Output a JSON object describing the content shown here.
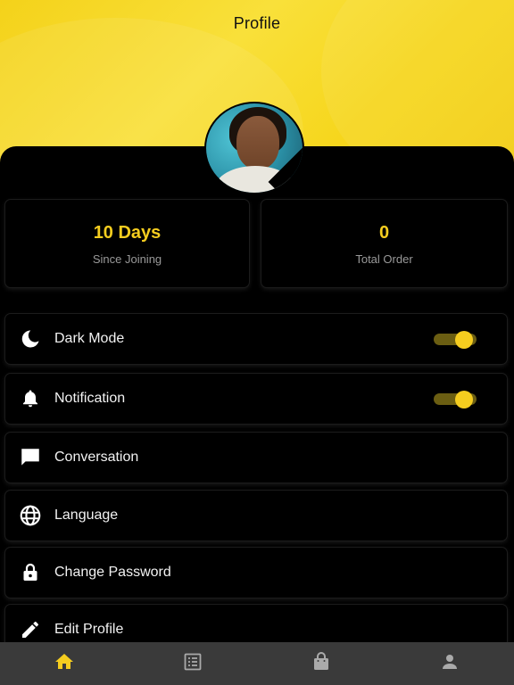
{
  "header": {
    "title": "Profile"
  },
  "stats": [
    {
      "value": "10 Days",
      "label": "Since Joining"
    },
    {
      "value": "0",
      "label": "Total Order"
    }
  ],
  "menu": {
    "items": [
      {
        "label": "Dark Mode",
        "icon": "moon-icon",
        "toggle": true
      },
      {
        "label": "Notification",
        "icon": "bell-icon",
        "toggle": true
      },
      {
        "label": "Conversation",
        "icon": "chat-icon"
      },
      {
        "label": "Language",
        "icon": "globe-icon"
      },
      {
        "label": "Change Password",
        "icon": "lock-icon"
      },
      {
        "label": "Edit Profile",
        "icon": "pencil-icon"
      }
    ]
  },
  "bottom_nav": {
    "items": [
      {
        "icon": "home-icon",
        "active": true
      },
      {
        "icon": "list-icon",
        "active": false
      },
      {
        "icon": "bag-icon",
        "active": false
      },
      {
        "icon": "person-icon",
        "active": false
      }
    ]
  },
  "colors": {
    "accent": "#f5cd1f",
    "background": "#000000",
    "nav": "#3a3a3a"
  }
}
